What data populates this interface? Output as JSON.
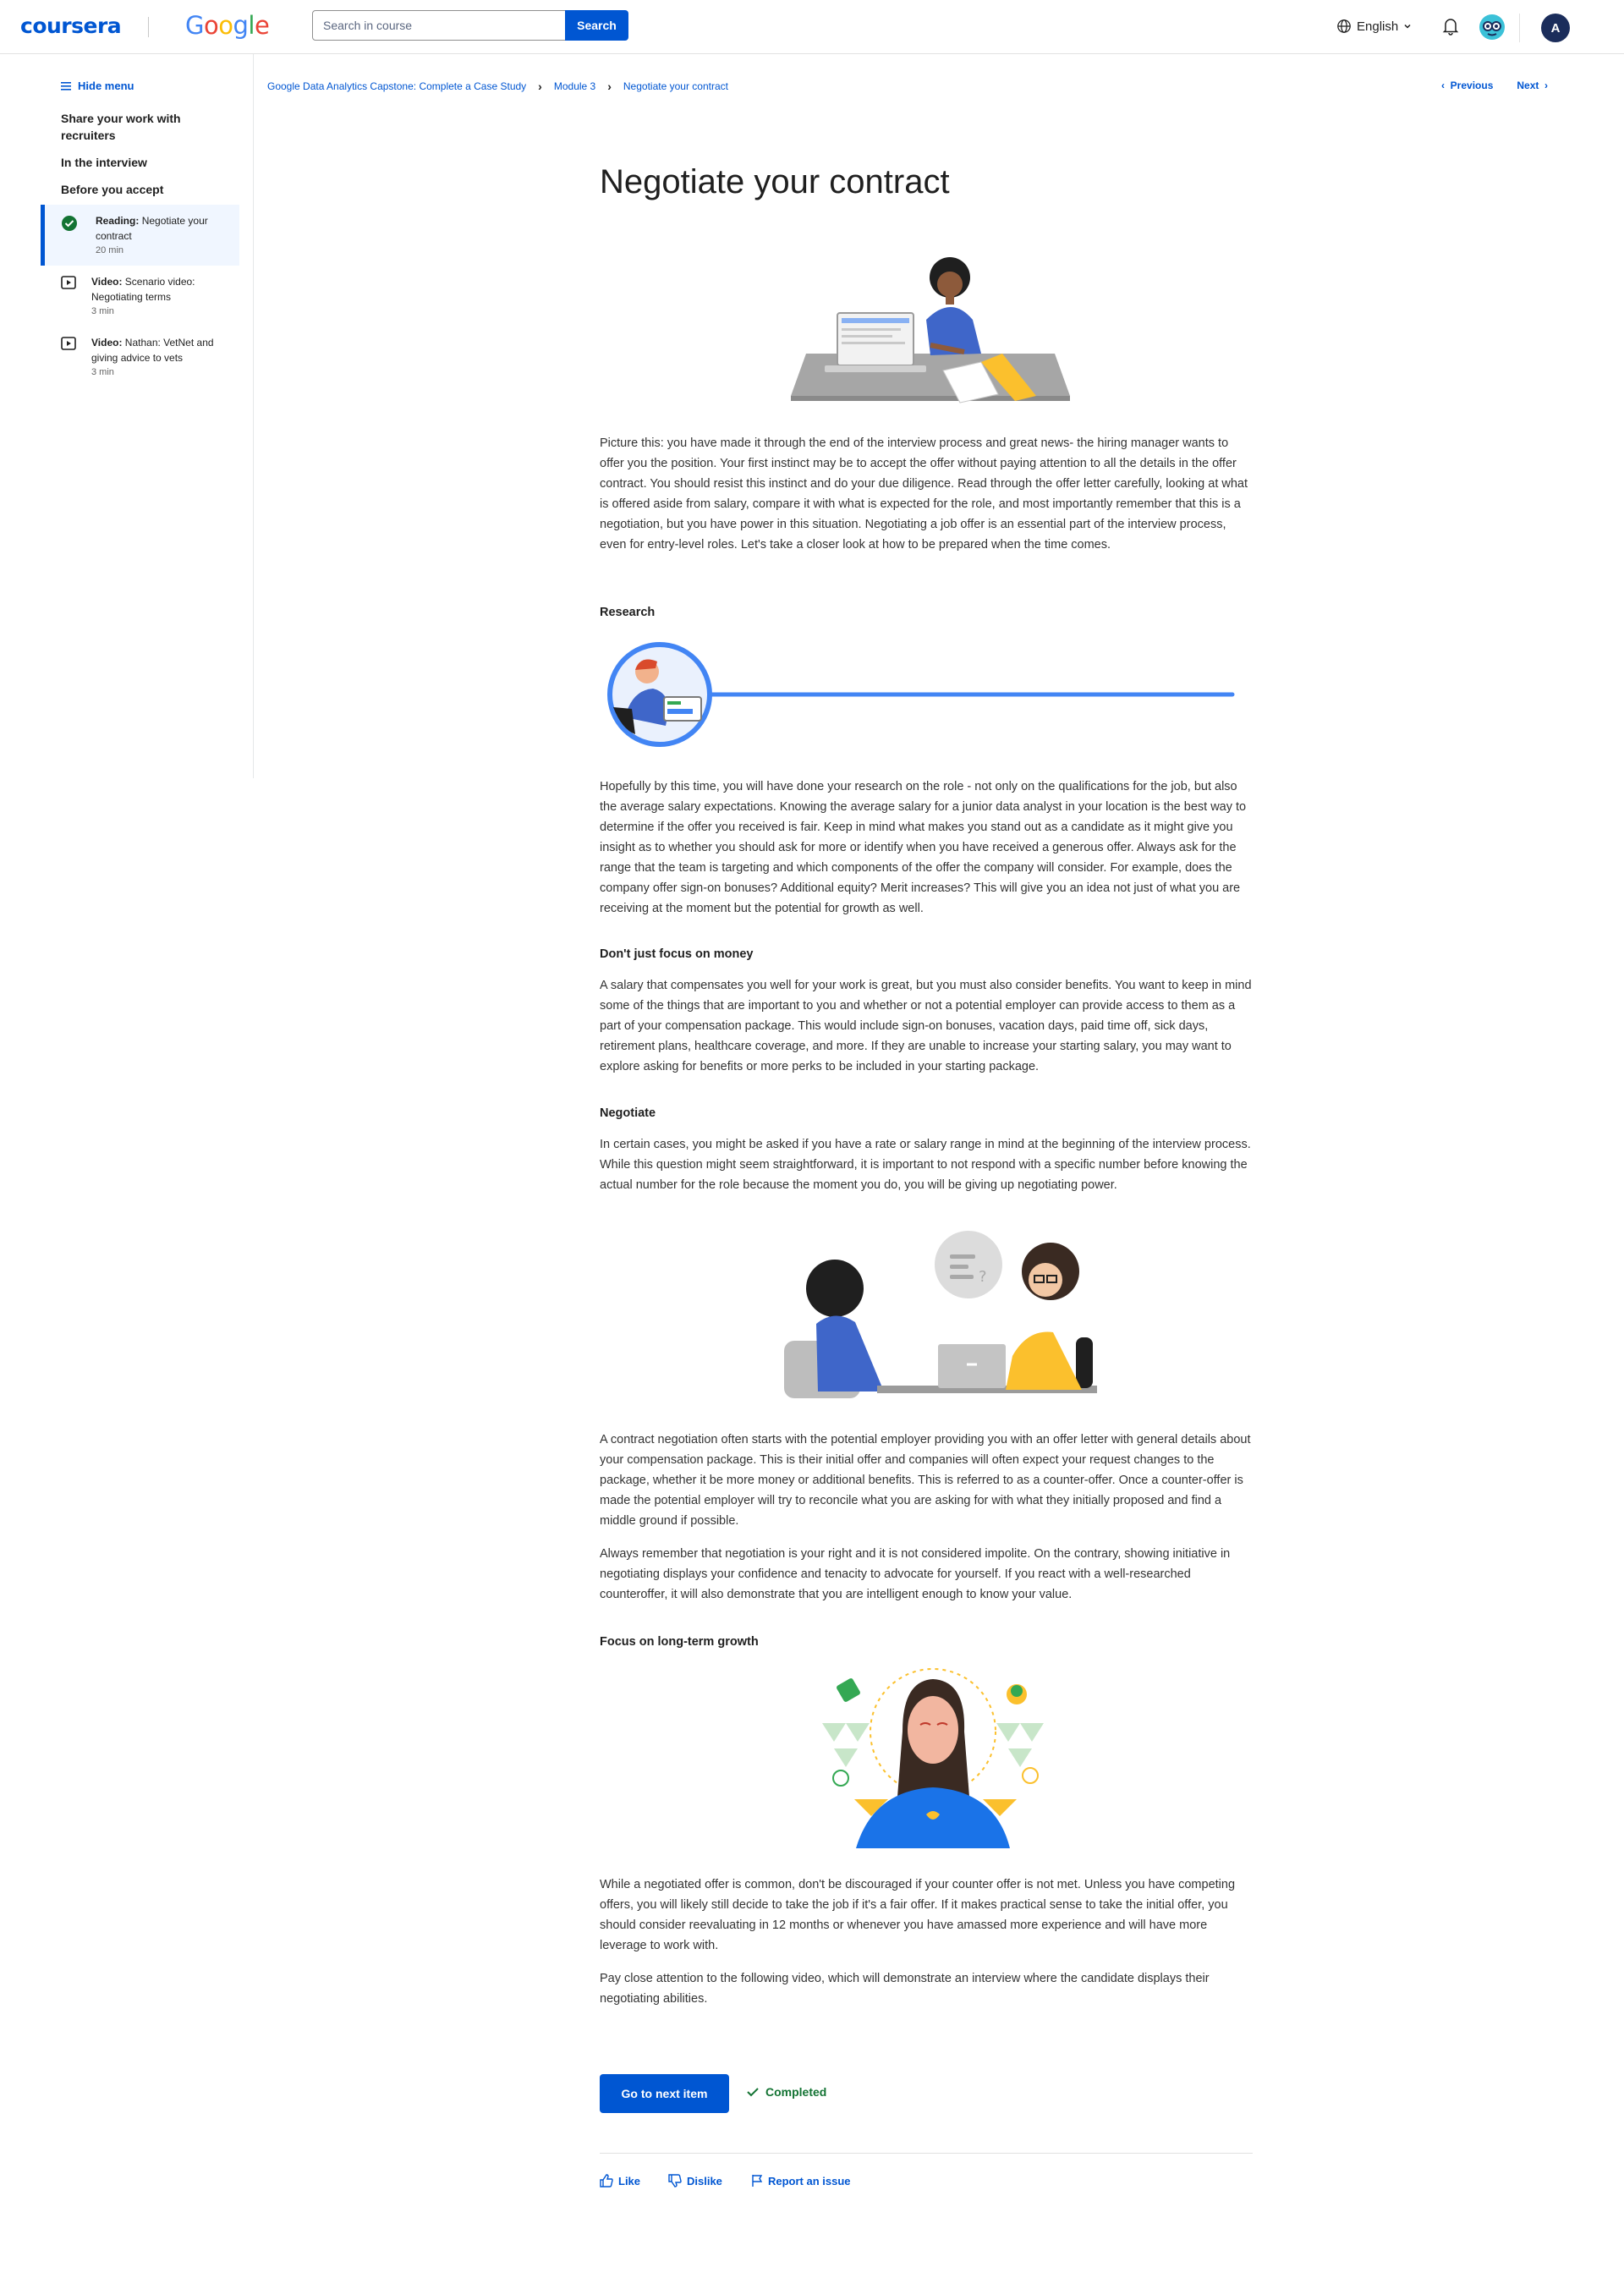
{
  "header": {
    "logo_coursera": "coursera",
    "logo_google": "Google",
    "search": {
      "placeholder": "Search in course",
      "button_label": "Search"
    },
    "language": "English",
    "avatar_initial": "A"
  },
  "sidebar": {
    "hide_menu_label": "Hide menu",
    "groups": [
      "Share your work with recruiters",
      "In the interview",
      "Before you accept"
    ],
    "items": [
      {
        "type": "Reading:",
        "title": "Negotiate your contract",
        "duration": "20 min",
        "active": true,
        "icon": "check-circle-icon"
      },
      {
        "type": "Video:",
        "title": "Scenario video: Negotiating terms",
        "duration": "3 min",
        "active": false,
        "icon": "video-icon"
      },
      {
        "type": "Video:",
        "title": "Nathan: VetNet and giving advice to vets",
        "duration": "3 min",
        "active": false,
        "icon": "video-icon"
      }
    ]
  },
  "breadcrumb": [
    "Google Data Analytics Capstone: Complete a Case Study",
    "Module 3",
    "Negotiate your contract"
  ],
  "nav": {
    "previous": "Previous",
    "next": "Next"
  },
  "article": {
    "title": "Negotiate your contract",
    "intro": "Picture this: you have made it through the end of the interview process and great news- the hiring manager wants to offer you the position. Your first instinct may be to accept the offer without paying attention to all the details in the offer contract. You should resist this instinct and do your due diligence. Read through the offer letter carefully, looking at what is offered aside from salary, compare it with what is expected for the role, and most importantly remember that this is a negotiation, but you have power in this situation. Negotiating a job offer is an essential part of the interview process, even for entry-level roles. Let's take a closer look at how to be prepared when the time comes.",
    "research_heading": "Research",
    "research_text": "Hopefully by this time, you will have done your research on the role - not only on the qualifications for the job, but also the average salary expectations. Knowing the average salary for a junior data analyst in your location is the best way to determine if the offer you received is fair. Keep in mind what makes you stand out as a candidate as it might give you insight as to whether you should ask for more or identify when you have received a generous offer. Always ask for the range that the team is targeting and which components of the offer the company will consider. For example, does the company offer sign-on bonuses? Additional equity? Merit increases? This will give you an idea not just of what you are receiving at the moment but the potential for growth as well.",
    "money_heading": "Don't just focus on money",
    "money_text": "A salary that compensates you well for your work is great, but you must also consider benefits. You want to keep in mind some of the things that are important to you and whether or not a potential employer can provide access to them as a part of your compensation package. This would include sign-on bonuses, vacation days, paid time off, sick days, retirement plans, healthcare coverage, and more. If they are unable to increase your starting salary, you may want to explore asking for benefits or more perks to be included in your starting package.",
    "negotiate_heading": "Negotiate",
    "negotiate_text": "In certain cases, you might be asked if you have a rate or salary range in mind at the beginning of the interview process. While this question might seem straightforward, it is important to not respond with a specific number before knowing the actual number for the role because the moment you do, you will be giving up negotiating power.",
    "counter_text": "A contract negotiation often starts with the potential employer providing you with an offer letter with general details about your compensation package. This is their initial offer and companies will often expect your request changes to the package, whether it be more money or additional benefits. This is referred to as a counter-offer. Once a counter-offer is made the potential employer will try to reconcile what you are asking for with what they initially proposed and find a middle ground if possible.",
    "remember_text": "Always remember that negotiation is your right and it is not considered impolite. On the contrary, showing initiative in negotiating displays your confidence and tenacity to advocate for yourself. If you react with a well-researched counteroffer, it will also demonstrate that you are intelligent enough to know your value.",
    "growth_heading": "Focus on long-term growth",
    "growth_text": "While a negotiated offer is common, don't be discouraged if your counter offer is not met.  Unless you have competing offers, you will likely still decide to take the job if it's a fair offer. If it makes practical sense to take the initial offer, you should consider reevaluating in 12 months or whenever you have amassed more experience and will have more leverage to work with.",
    "video_text": "Pay close attention to the following video, which will demonstrate an interview where the candidate displays their negotiating abilities."
  },
  "actions": {
    "next_item": "Go to next item",
    "completed": "Completed"
  },
  "footer": {
    "like": "Like",
    "dislike": "Dislike",
    "report": "Report an issue"
  },
  "colors": {
    "accent": "#0056d2",
    "success": "#137333",
    "sidebar_active_bg": "#f0f6ff"
  }
}
